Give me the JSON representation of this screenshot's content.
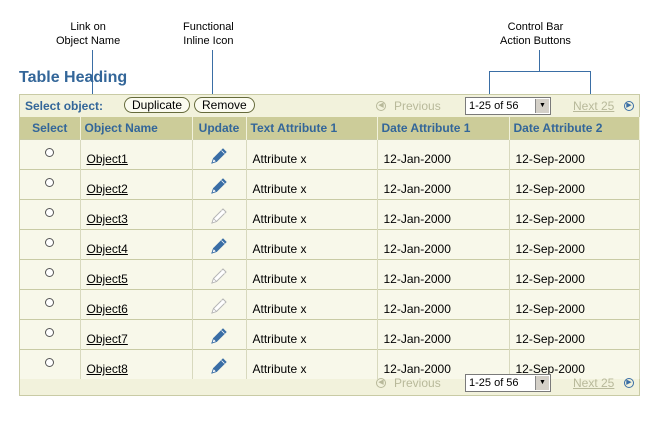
{
  "callouts": {
    "link": [
      "Link on",
      "Object Name"
    ],
    "icon": [
      "Functional",
      "Inline Icon"
    ],
    "control": [
      "Control Bar",
      "Action Buttons"
    ]
  },
  "table_heading": "Table Heading",
  "control_bar": {
    "select_label": "Select object:",
    "duplicate_label": "Duplicate",
    "remove_label": "Remove",
    "previous_label": "Previous",
    "range_value": "1-25 of 56",
    "next_label": "Next 25"
  },
  "columns": [
    "Select",
    "Object Name",
    "Update",
    "Text Attribute 1",
    "Date Attribute 1",
    "Date Attribute 2"
  ],
  "rows": [
    {
      "name": "Object1",
      "icon_active": true,
      "text": "Attribute x",
      "date1": "12-Jan-2000",
      "date2": "12-Sep-2000"
    },
    {
      "name": "Object2",
      "icon_active": true,
      "text": "Attribute x",
      "date1": "12-Jan-2000",
      "date2": "12-Sep-2000"
    },
    {
      "name": "Object3",
      "icon_active": false,
      "text": "Attribute x",
      "date1": "12-Jan-2000",
      "date2": "12-Sep-2000"
    },
    {
      "name": "Object4",
      "icon_active": true,
      "text": "Attribute x",
      "date1": "12-Jan-2000",
      "date2": "12-Sep-2000"
    },
    {
      "name": "Object5",
      "icon_active": false,
      "text": "Attribute x",
      "date1": "12-Jan-2000",
      "date2": "12-Sep-2000"
    },
    {
      "name": "Object6",
      "icon_active": false,
      "text": "Attribute x",
      "date1": "12-Jan-2000",
      "date2": "12-Sep-2000"
    },
    {
      "name": "Object7",
      "icon_active": true,
      "text": "Attribute x",
      "date1": "12-Jan-2000",
      "date2": "12-Sep-2000"
    },
    {
      "name": "Object8",
      "icon_active": true,
      "text": "Attribute x",
      "date1": "12-Jan-2000",
      "date2": "12-Sep-2000"
    }
  ],
  "colors": {
    "heading": "#336699",
    "header_bg": "#cccc99",
    "frame_bg": "#f2f2dc",
    "icon_active": "#3a6ea5",
    "icon_inactive": "#b5b5b5",
    "nav_disabled": "#b8b99a"
  },
  "icons": {
    "update": "pencil-icon",
    "previous": "previous-circle-icon",
    "next": "next-circle-icon",
    "dropdown": "dropdown-arrow-icon"
  }
}
